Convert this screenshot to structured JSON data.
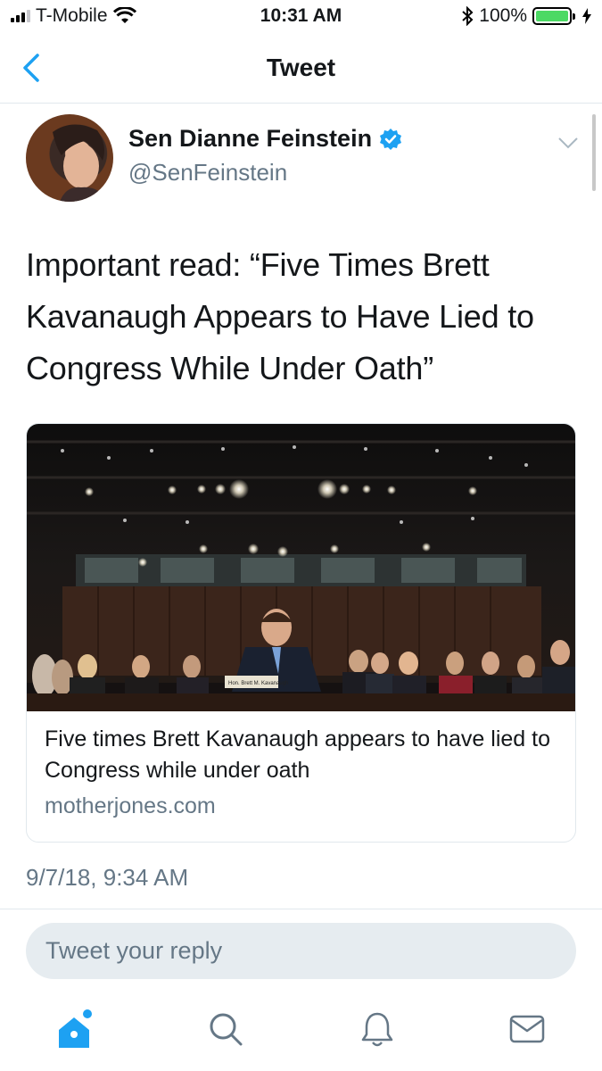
{
  "status_bar": {
    "carrier": "T-Mobile",
    "time": "10:31 AM",
    "battery": "100%",
    "icons": [
      "signal-icon",
      "wifi-icon",
      "bluetooth-icon",
      "battery-icon",
      "charging-icon"
    ]
  },
  "nav": {
    "title": "Tweet",
    "back_icon": "chevron-left-icon"
  },
  "tweet": {
    "author_name": "Sen Dianne Feinstein",
    "author_handle": "@SenFeinstein",
    "verified": true,
    "text": "Important read: “Five Times Brett Kavanaugh Appears to Have Lied to Congress While Under Oath”",
    "timestamp": "9/7/18, 9:34 AM"
  },
  "card": {
    "title": "Five times Brett Kavanaugh appears to have lied to Congress while under oath",
    "domain": "motherjones.com",
    "nameplate": "Hon. Brett M. Kavanaugh"
  },
  "reply": {
    "placeholder": "Tweet your reply"
  },
  "tab_bar": {
    "tabs": [
      "home-icon",
      "search-icon",
      "notifications-icon",
      "messages-icon"
    ],
    "active_color": "#1da1f2",
    "inactive_color": "#657786"
  },
  "colors": {
    "accent": "#1da1f2",
    "text": "#14171a",
    "secondary": "#657786",
    "border": "#e1e8ed",
    "battery": "#4cd964"
  }
}
